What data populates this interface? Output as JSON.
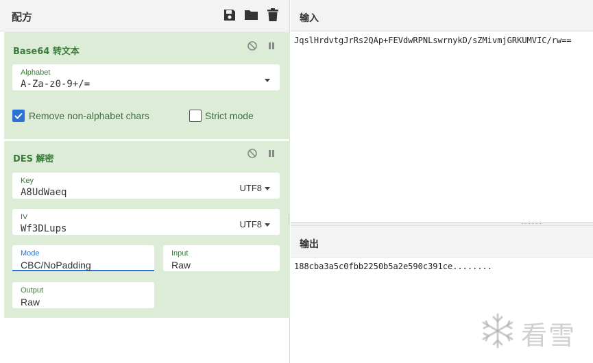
{
  "recipe": {
    "title": "配方",
    "icons": [
      "save-icon",
      "folder-icon",
      "trash-icon"
    ]
  },
  "operations": [
    {
      "title": "Base64 转文本",
      "alphabet": {
        "label": "Alphabet",
        "value": "A-Za-z0-9+/="
      },
      "remove_non_alphabet": {
        "label": "Remove non-alphabet chars",
        "checked": true
      },
      "strict_mode": {
        "label": "Strict mode",
        "checked": false
      }
    },
    {
      "title": "DES 解密",
      "key": {
        "label": "Key",
        "value": "A8UdWaeq",
        "encoding": "UTF8"
      },
      "iv": {
        "label": "IV",
        "value": "Wf3DLups",
        "encoding": "UTF8"
      },
      "mode": {
        "label": "Mode",
        "value": "CBC/NoPadding"
      },
      "input": {
        "label": "Input",
        "value": "Raw"
      },
      "output": {
        "label": "Output",
        "value": "Raw"
      }
    }
  ],
  "input_pane": {
    "title": "输入",
    "text": "JqslHrdvtgJrRs2QAp+FEVdwRPNLswrnykD/sZMivmjGRKUMVIC/rw=="
  },
  "output_pane": {
    "title": "输出",
    "text": "188cba3a5c0fbb2250b5a2e590c391ce........"
  },
  "watermark": {
    "text": "看雪"
  },
  "colors": {
    "accent_green": "#3a7a3a",
    "op_background": "#dcecd6",
    "checkbox_blue": "#2a72d4"
  }
}
